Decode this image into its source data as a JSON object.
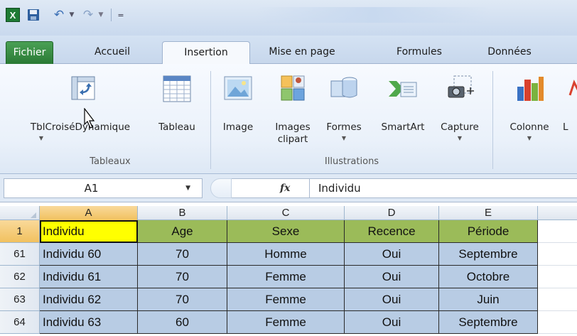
{
  "quick_access": {
    "app_icon_letter": "X",
    "customize_glyph": "="
  },
  "tabs": [
    {
      "label": "Fichier"
    },
    {
      "label": "Accueil"
    },
    {
      "label": "Insertion"
    },
    {
      "label": "Mise en page"
    },
    {
      "label": "Formules"
    },
    {
      "label": "Données"
    }
  ],
  "ribbon": {
    "buttons": {
      "pivot": "TblCroiséDynamique",
      "table": "Tableau",
      "image": "Image",
      "clipart_line1": "Images",
      "clipart_line2": "clipart",
      "shapes": "Formes",
      "smartart": "SmartArt",
      "capture": "Capture",
      "column": "Colonne",
      "next_partial": "L"
    },
    "groups": {
      "tableaux": "Tableaux",
      "illustrations": "Illustrations"
    }
  },
  "formula_bar": {
    "name_box": "A1",
    "fx_label": "fx",
    "formula": "Individu"
  },
  "grid": {
    "columns": [
      "A",
      "B",
      "C",
      "D",
      "E"
    ],
    "header_row": {
      "row_number": "1",
      "cells": [
        "Individu",
        "Age",
        "Sexe",
        "Recence",
        "Période"
      ]
    },
    "rows": [
      {
        "row_number": "61",
        "cells": [
          "Individu 60",
          "70",
          "Homme",
          "Oui",
          "Septembre"
        ]
      },
      {
        "row_number": "62",
        "cells": [
          "Individu 61",
          "70",
          "Femme",
          "Oui",
          "Octobre"
        ]
      },
      {
        "row_number": "63",
        "cells": [
          "Individu 62",
          "70",
          "Femme",
          "Oui",
          "Juin"
        ]
      },
      {
        "row_number": "64",
        "cells": [
          "Individu 63",
          "60",
          "Femme",
          "Oui",
          "Septembre"
        ]
      }
    ]
  },
  "colors": {
    "header_green": "#9bbb59",
    "header_yellow": "#ffff00",
    "data_blue": "#b8cce4",
    "fichier_green": "#2a7a35"
  }
}
